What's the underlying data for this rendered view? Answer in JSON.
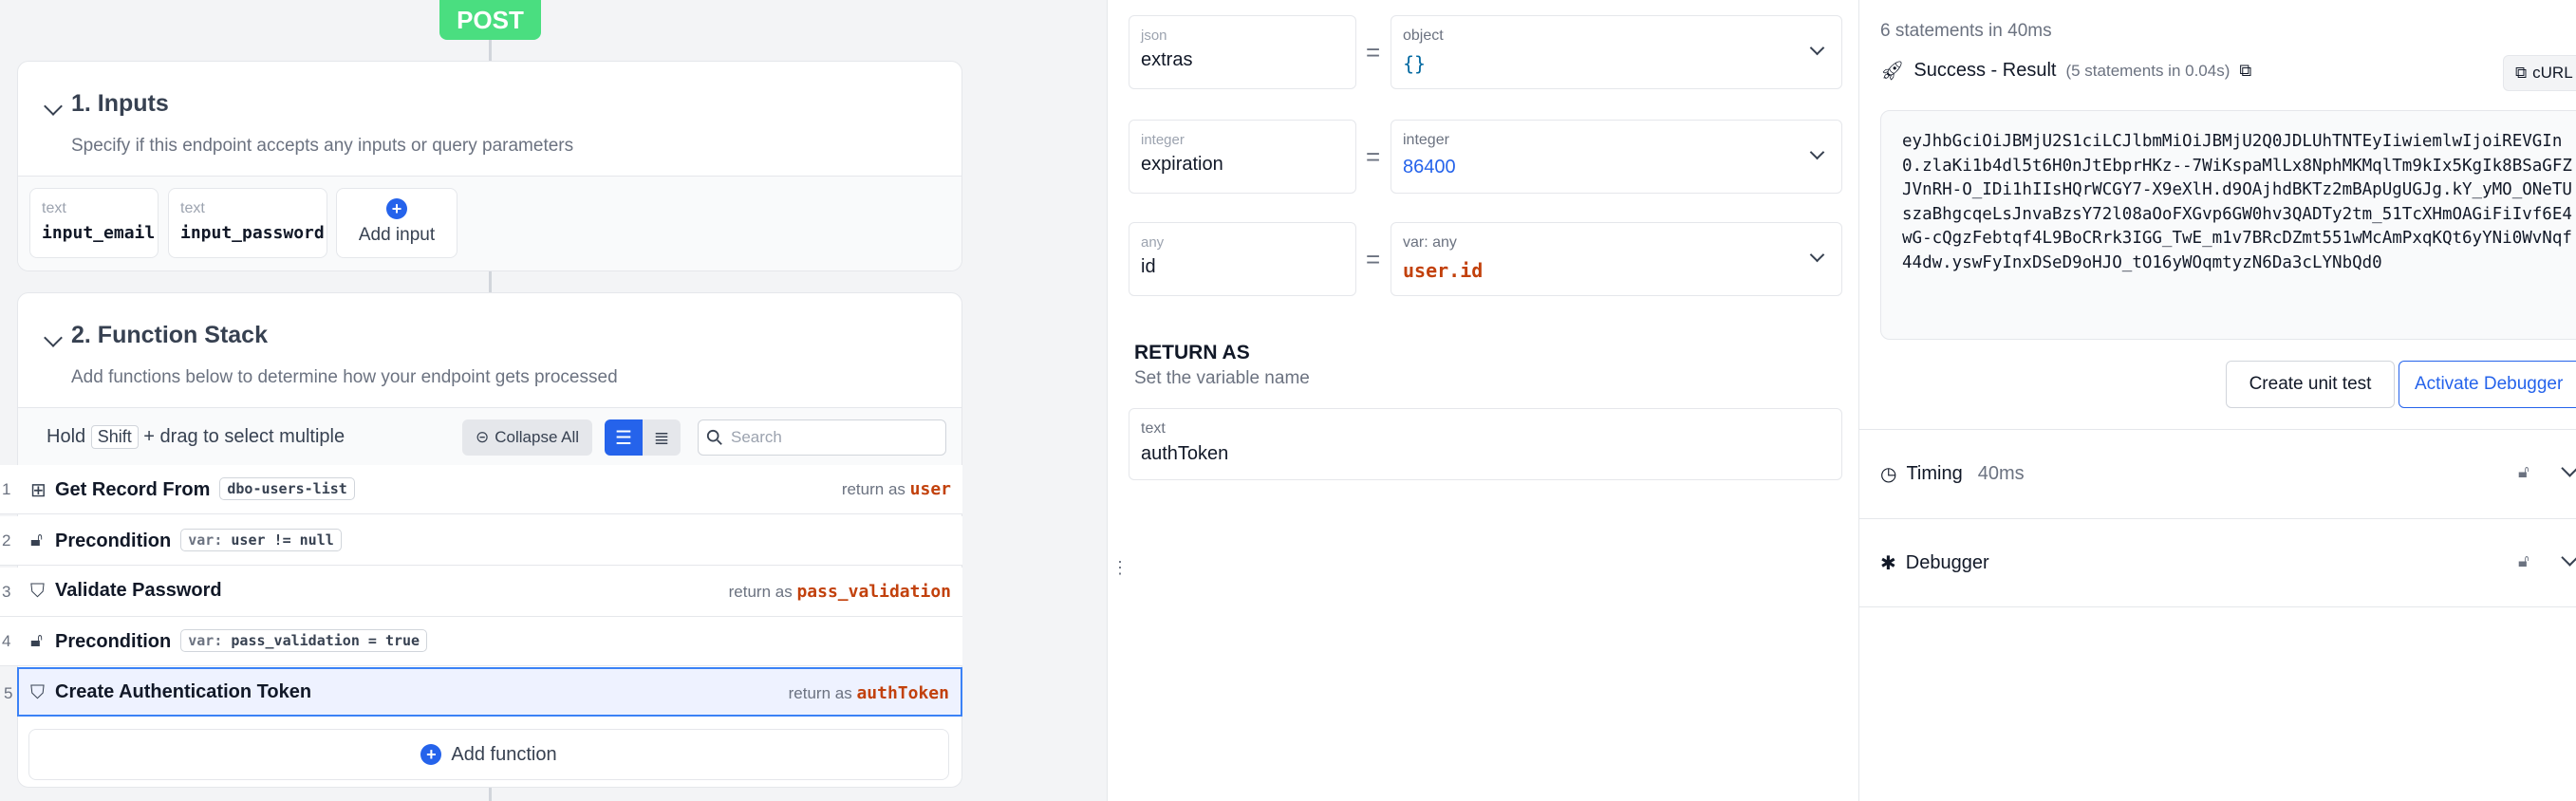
{
  "method": "POST",
  "inputs_section": {
    "title": "1. Inputs",
    "subtitle": "Specify if this endpoint accepts any inputs or query parameters",
    "inputs": [
      {
        "type": "text",
        "name": "input_email"
      },
      {
        "type": "text",
        "name": "input_password"
      }
    ],
    "add_label": "Add input"
  },
  "function_section": {
    "title": "2. Function Stack",
    "subtitle": "Add functions below to determine how your endpoint gets processed",
    "hold_prefix": "Hold",
    "hold_key": "Shift",
    "hold_suffix": "+ drag to select multiple",
    "collapse_label": "Collapse All",
    "search_placeholder": "Search",
    "steps": [
      {
        "num": "1",
        "icon": "table-icon",
        "name": "Get Record From",
        "chip": "dbo-users-list",
        "return_prefix": "return as",
        "return_var": "user"
      },
      {
        "num": "2",
        "icon": "lock-icon",
        "name": "Precondition",
        "chip_key": "var:",
        "chip": "user != null"
      },
      {
        "num": "3",
        "icon": "shield-check-icon",
        "name": "Validate Password",
        "return_prefix": "return as",
        "return_var": "pass_validation"
      },
      {
        "num": "4",
        "icon": "lock-icon",
        "name": "Precondition",
        "chip_key": "var:",
        "chip": "pass_validation = true"
      },
      {
        "num": "5",
        "icon": "shield-check-icon",
        "name": "Create Authentication Token",
        "return_prefix": "return as",
        "return_var": "authToken"
      }
    ],
    "add_function_label": "Add function"
  },
  "variables": [
    {
      "label": "json",
      "name": "extras",
      "type": "object",
      "value": "{}",
      "value_color": "#0369a1"
    },
    {
      "label": "integer",
      "name": "expiration",
      "type": "integer",
      "value": "86400",
      "value_color": "#2563eb"
    },
    {
      "label": "any",
      "name": "id",
      "type": "var: any",
      "value": "user.id",
      "value_color": "#c2410c"
    }
  ],
  "return_as": {
    "title": "RETURN AS",
    "subtitle": "Set the variable name",
    "label": "text",
    "value": "authToken"
  },
  "result": {
    "statements": "6 statements in 40ms",
    "status": "Success - Result",
    "status_detail": "(5 statements in 0.04s)",
    "curl_label": "cURL",
    "token": "eyJhbGciOiJBMjU2S1ciLCJlbmMiOiJBMjU2Q0JDLUhTNTEyIiwiemlwIjoiREVGIn0.zlaKi1b4dl5t6H0nJtEbprHKz--7WiKspaMlLx8NphMKMqlTm9kIx5KgIk8BSaGFZJVnRH-O_IDi1hIIsHQrWCGY7-X9eXlH.d9OAjhdBKTz2mBApUgUGJg.kY_yMO_ONeTUszaBhgcqeLsJnvaBzsY72l08aOoFXGvp6GW0hv3QADTy2tm_51TcXHmOAGiFiIvf6E4wG-cQgzFebtqf4L9BoCRrk3IGG_TwE_m1v7BRcDZmt551wMcAmPxqKQt6yYNi0WvNqf44dw.yswFyInxDSeD9oHJO_tO16yWOqmtyzN6Da3cLYNbQd0",
    "create_test_label": "Create unit test",
    "activate_label": "Activate Debugger",
    "timing_label": "Timing",
    "timing_value": "40ms",
    "debugger_label": "Debugger"
  },
  "colors": {
    "accent": "#2563eb",
    "post": "#4ade80",
    "return_var": "#c2410c",
    "selected_row": "#eef2ff"
  }
}
